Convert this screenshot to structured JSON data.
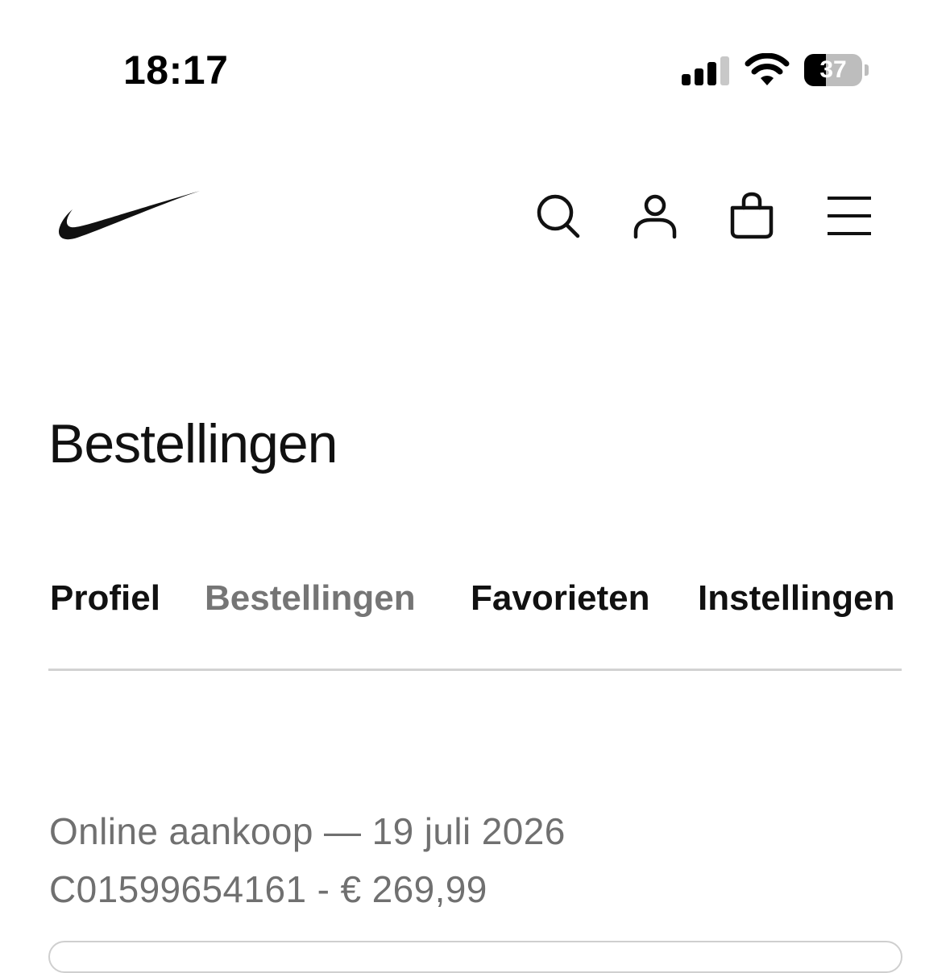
{
  "status_bar": {
    "time": "18:17",
    "battery_percent": "37",
    "battery_level": 0.37,
    "signal_bars_active": 3,
    "signal_bars_total": 4
  },
  "nav": {
    "logo": "nike-swoosh-logo",
    "icons": [
      "search-icon",
      "account-icon",
      "bag-icon",
      "menu-icon"
    ]
  },
  "page": {
    "title": "Bestellingen"
  },
  "tabs": [
    {
      "label": "Profiel",
      "active": false
    },
    {
      "label": "Bestellingen",
      "active": true
    },
    {
      "label": "Favorieten",
      "active": false
    },
    {
      "label": "Instellingen",
      "active": false
    }
  ],
  "order": {
    "line1": "Online aankoop — 19 juli 2026",
    "line2": "C01599654161 - € 269,99"
  },
  "colors": {
    "text": "#111111",
    "muted": "#757575",
    "divider": "#d2d2d2",
    "background": "#ffffff"
  }
}
